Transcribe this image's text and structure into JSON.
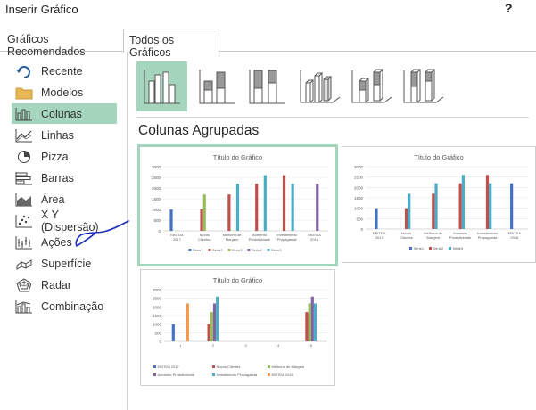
{
  "window": {
    "title": "Inserir Gráfico",
    "help": "?"
  },
  "tabs": [
    {
      "label": "Gráficos Recomendados",
      "selected": false
    },
    {
      "label": "Todos os Gráficos",
      "selected": true
    }
  ],
  "sidebar": {
    "items": [
      {
        "label": "Recente",
        "icon": "recent-icon"
      },
      {
        "label": "Modelos",
        "icon": "folder-icon"
      },
      {
        "label": "Colunas",
        "icon": "column-chart-icon",
        "selected": true
      },
      {
        "label": "Linhas",
        "icon": "line-chart-icon"
      },
      {
        "label": "Pizza",
        "icon": "pie-chart-icon"
      },
      {
        "label": "Barras",
        "icon": "bar-chart-icon"
      },
      {
        "label": "Área",
        "icon": "area-chart-icon"
      },
      {
        "label": "X Y (Dispersão)",
        "icon": "scatter-chart-icon"
      },
      {
        "label": "Ações",
        "icon": "stock-chart-icon"
      },
      {
        "label": "Superfície",
        "icon": "surface-chart-icon"
      },
      {
        "label": "Radar",
        "icon": "radar-chart-icon"
      },
      {
        "label": "Combinação",
        "icon": "combo-chart-icon"
      }
    ]
  },
  "subtypes": {
    "icons": [
      {
        "name": "clustered-column-icon",
        "selected": true
      },
      {
        "name": "stacked-column-icon"
      },
      {
        "name": "stacked-100-column-icon"
      },
      {
        "name": "3d-clustered-column-icon"
      },
      {
        "name": "3d-stacked-column-icon"
      },
      {
        "name": "3d-stacked-100-column-icon"
      }
    ],
    "selected_title": "Colunas Agrupadas"
  },
  "colors": {
    "selection": "#a6d5bd",
    "series": [
      "#4472c4",
      "#c0504d",
      "#9bbb59",
      "#8064a2",
      "#4bacc6",
      "#f79646"
    ]
  },
  "chart_data": [
    {
      "type": "bar",
      "title": "Título do Gráfico",
      "categories": [
        "EBITDA 2017",
        "Novos Clientes",
        "Melhoria de Margem",
        "Aumento Produtividade",
        "Investimento Propaganda",
        "EBITDA 2018"
      ],
      "series": [
        {
          "name": "Série1",
          "values": [
            1000,
            0,
            0,
            0,
            0,
            0
          ]
        },
        {
          "name": "Série2",
          "values": [
            0,
            1000,
            1700,
            2200,
            2600,
            0
          ]
        },
        {
          "name": "Série3",
          "values": [
            0,
            1700,
            0,
            0,
            0,
            0
          ]
        },
        {
          "name": "Série4",
          "values": [
            0,
            0,
            0,
            0,
            0,
            2200
          ]
        },
        {
          "name": "Série5",
          "values": [
            0,
            0,
            2200,
            2600,
            2200,
            0
          ]
        }
      ],
      "y_ticks": [
        "0",
        "500",
        "1000",
        "1500",
        "2000",
        "2500",
        "3000"
      ],
      "ylim": [
        0,
        3000
      ],
      "legend": "bottom"
    },
    {
      "type": "bar",
      "title": "Título do Gráfico",
      "categories": [
        "EBITDA 2017",
        "Novos Clientes",
        "Melhoria de Margem",
        "Aumento Produtividade",
        "Investimento Propaganda",
        "EBITDA 2018"
      ],
      "series": [
        {
          "name": "Série1",
          "values": [
            1000,
            0,
            0,
            0,
            0,
            2200
          ]
        },
        {
          "name": "Série2",
          "values": [
            0,
            1000,
            1700,
            2200,
            2600,
            0
          ]
        },
        {
          "name": "Série5",
          "values": [
            0,
            1700,
            2200,
            2600,
            2200,
            0
          ]
        }
      ],
      "y_ticks": [
        "0",
        "500",
        "1000",
        "1500",
        "2000",
        "2500",
        "3000"
      ],
      "ylim": [
        0,
        3000
      ],
      "legend": "bottom"
    },
    {
      "type": "bar",
      "title": "Título do Gráfico",
      "categories": [
        "1",
        "2",
        "3",
        "4",
        "5"
      ],
      "series": [
        {
          "name": "EBITDA 2017",
          "values": [
            1000,
            0,
            0,
            0,
            0
          ]
        },
        {
          "name": "Novos Clientes",
          "values": [
            0,
            1000,
            0,
            0,
            1700
          ]
        },
        {
          "name": "Melhoria de Margem",
          "values": [
            0,
            1700,
            0,
            0,
            2200
          ]
        },
        {
          "name": "Aumento Produtividade",
          "values": [
            0,
            2200,
            0,
            0,
            2600
          ]
        },
        {
          "name": "Investimento Propaganda",
          "values": [
            0,
            2600,
            0,
            0,
            2200
          ]
        },
        {
          "name": "EBITDA 2018",
          "values": [
            2200,
            0,
            0,
            0,
            0
          ]
        }
      ],
      "y_ticks": [
        "0",
        "500",
        "1000",
        "1500",
        "2000",
        "2500",
        "3000"
      ],
      "ylim": [
        0,
        3000
      ],
      "legend": "bottom"
    }
  ]
}
